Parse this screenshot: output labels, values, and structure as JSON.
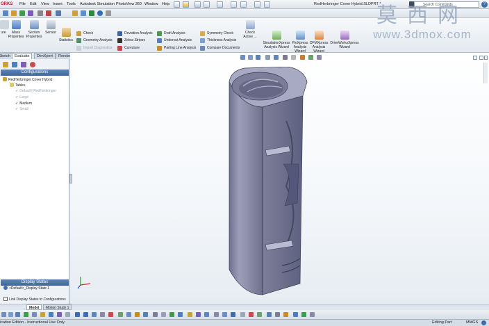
{
  "app": {
    "logo_text": "ORKS",
    "document_title": "RedHerbringer Cover Hybrid.SLDPRT *"
  },
  "menu": [
    "File",
    "Edit",
    "View",
    "Insert",
    "Tools",
    "Autodesk Simulation",
    "PhotoView 360",
    "Window",
    "Help"
  ],
  "search": {
    "placeholder": "Search Commands"
  },
  "ribbon": {
    "big_buttons": [
      {
        "label": "ure"
      },
      {
        "label": "Mass Properties"
      },
      {
        "label": "Section Properties"
      },
      {
        "label": "Sensor"
      },
      {
        "label": "Statistics"
      }
    ],
    "col1": [
      "Check",
      "Geometry Analysis",
      "Import Diagnostics"
    ],
    "col2": [
      "Deviation Analysis",
      "Zebra Stripes",
      "Curvature"
    ],
    "col3": [
      "Draft Analysis",
      "Undercut Analysis",
      "Parting Line Analysis"
    ],
    "col4": [
      "Symmetry Check",
      "Thickness Analysis",
      "Compare Documents"
    ],
    "check_active": "Check Active ...",
    "wizards": [
      {
        "label": "SimulationXpress Analysis Wizard"
      },
      {
        "label": "FloXpress Analysis Wizard"
      },
      {
        "label": "DFMXpress Analysis Wizard"
      },
      {
        "label": "DriveWorksXpress Wizard"
      }
    ]
  },
  "tabs": [
    "Sketch",
    "Evaluate",
    "DimXpert",
    "Render Tools"
  ],
  "configurations": {
    "header": "Configurations",
    "root": "RedHerbringer Cover Hybrid",
    "tables": "Tables",
    "items": [
      {
        "label": "Default [ RedHerbringer",
        "active": false
      },
      {
        "label": "Large",
        "active": false
      },
      {
        "label": "Medium",
        "active": true
      },
      {
        "label": "Small",
        "active": false
      }
    ]
  },
  "display_states": {
    "header": "Display States",
    "item": "<Default>_Display State 1",
    "link_label": "Link Display States to Configurations"
  },
  "bottom_tabs": [
    "Model",
    "Motion Study 1"
  ],
  "status": {
    "left": "ication Edition - Instructional Use Only",
    "mode": "Editing Part",
    "units": "MMGS"
  },
  "watermark": {
    "big": "莫西网",
    "url": "www.3dmox.com"
  },
  "colors": {
    "accent": "#3f679b",
    "model": "#8d8fa8"
  }
}
